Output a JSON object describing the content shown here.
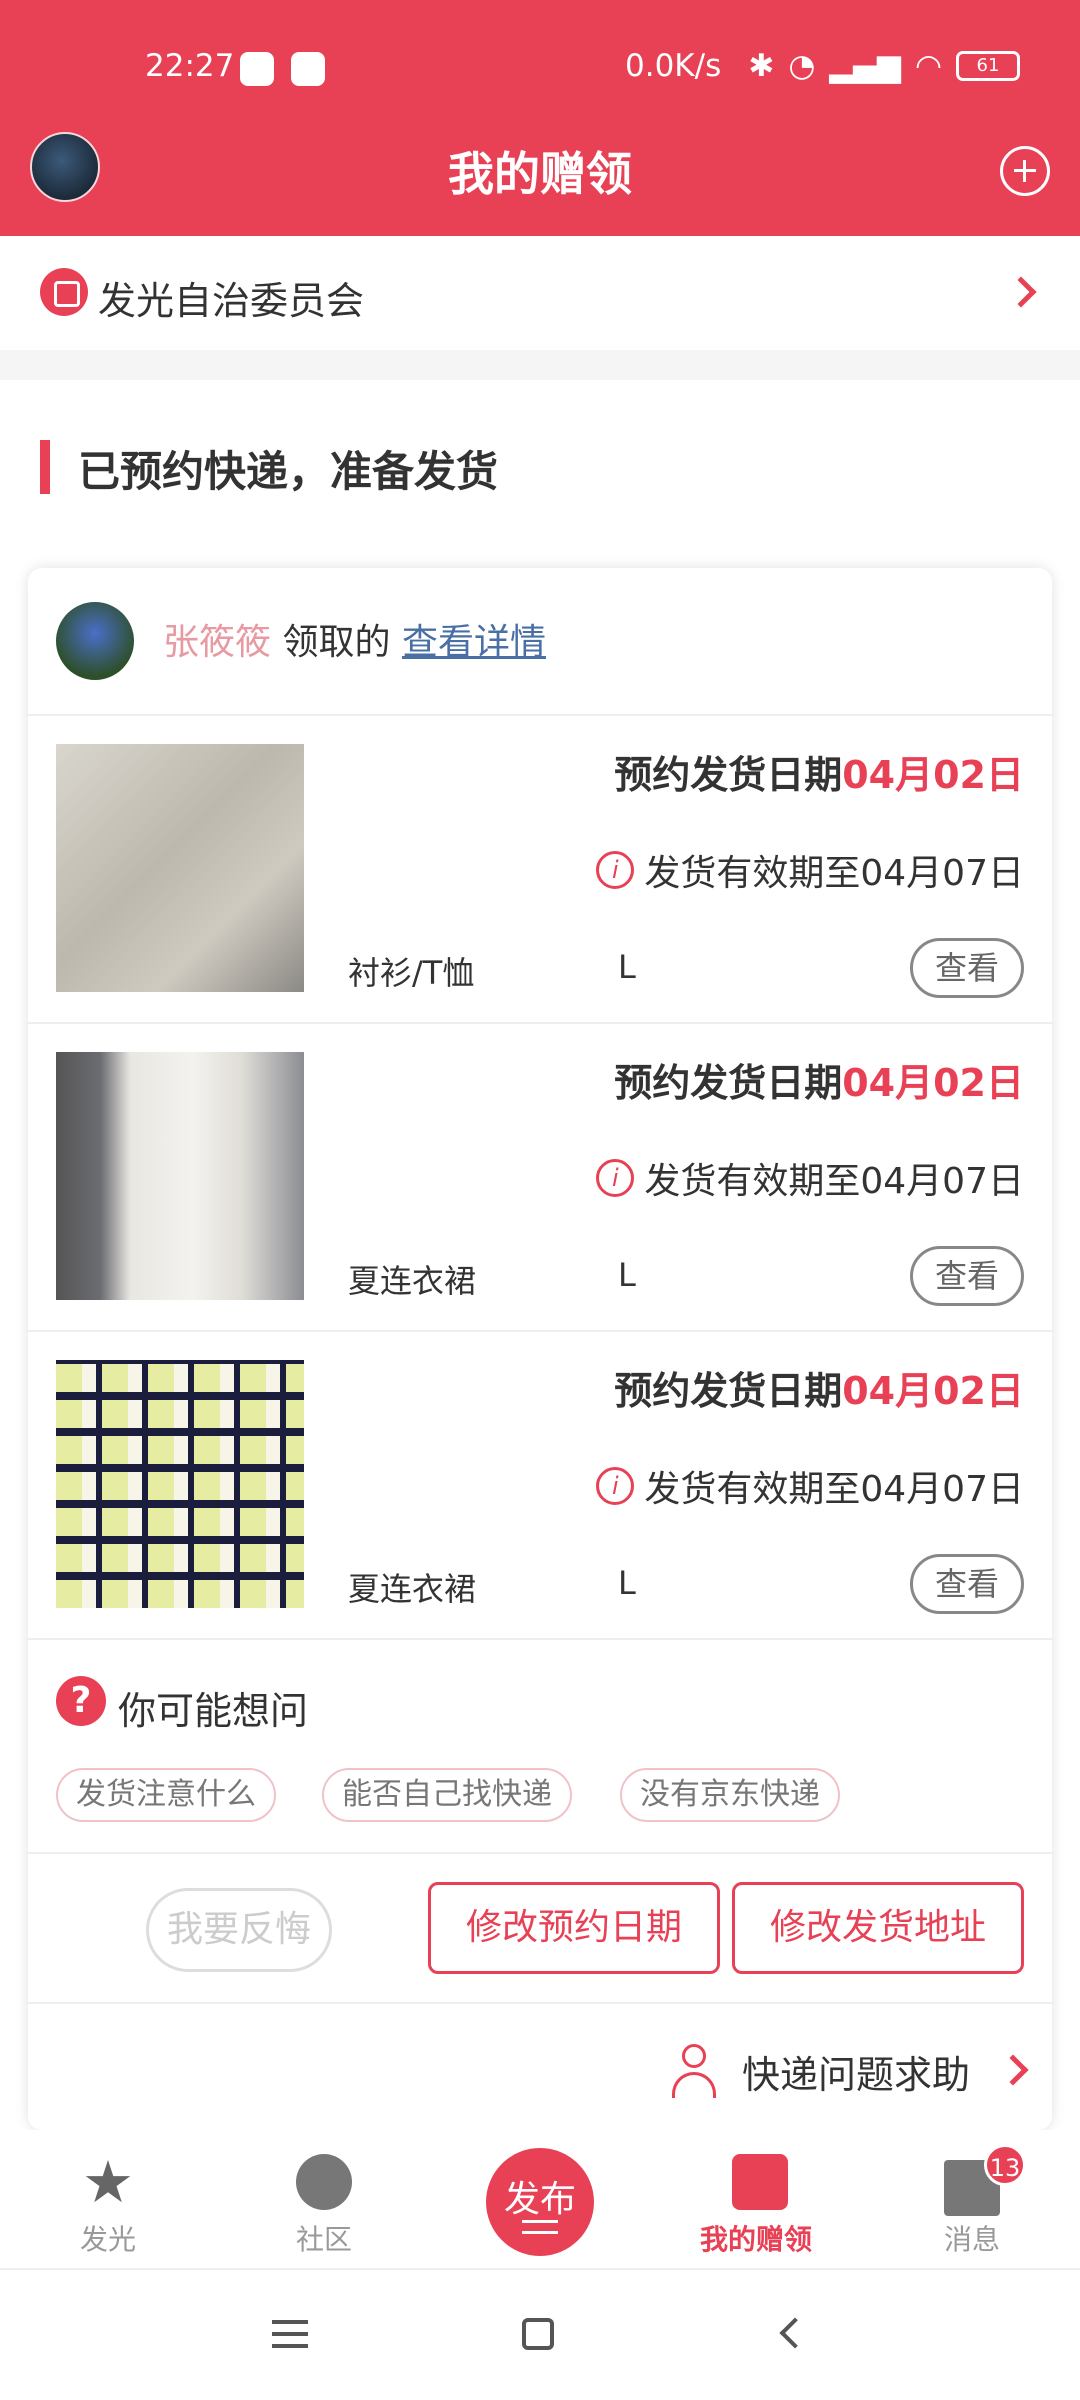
{
  "status_bar": {
    "time": "22:27",
    "net_speed": "0.0K/s",
    "battery": "61"
  },
  "header": {
    "title": "我的赠领"
  },
  "org": {
    "name": "发光自治委员会"
  },
  "section": {
    "title": "已预约快递，准备发货"
  },
  "receiver": {
    "name": "张筱筱",
    "action": "领取的",
    "link": "查看详情"
  },
  "items": [
    {
      "date_label": "预约发货日期",
      "date": "04月02日",
      "valid_until": "发货有效期至04月07日",
      "category": "衬衫/T恤",
      "size": "L",
      "view": "查看"
    },
    {
      "date_label": "预约发货日期",
      "date": "04月02日",
      "valid_until": "发货有效期至04月07日",
      "category": "夏连衣裙",
      "size": "L",
      "view": "查看"
    },
    {
      "date_label": "预约发货日期",
      "date": "04月02日",
      "valid_until": "发货有效期至04月07日",
      "category": "夏连衣裙",
      "size": "L",
      "view": "查看"
    }
  ],
  "faq": {
    "title": "你可能想问",
    "chips": [
      "发货注意什么",
      "能否自己找快递",
      "没有京东快递"
    ]
  },
  "actions": {
    "regret": "我要反悔",
    "change_date": "修改预约日期",
    "change_address": "修改发货地址"
  },
  "help": {
    "label": "快递问题求助"
  },
  "tabbar": {
    "tabs": [
      {
        "label": "发光"
      },
      {
        "label": "社区"
      },
      {
        "label": "发布"
      },
      {
        "label": "我的赠领"
      },
      {
        "label": "消息",
        "badge": "13"
      }
    ]
  },
  "colors": {
    "accent": "#e84155"
  }
}
